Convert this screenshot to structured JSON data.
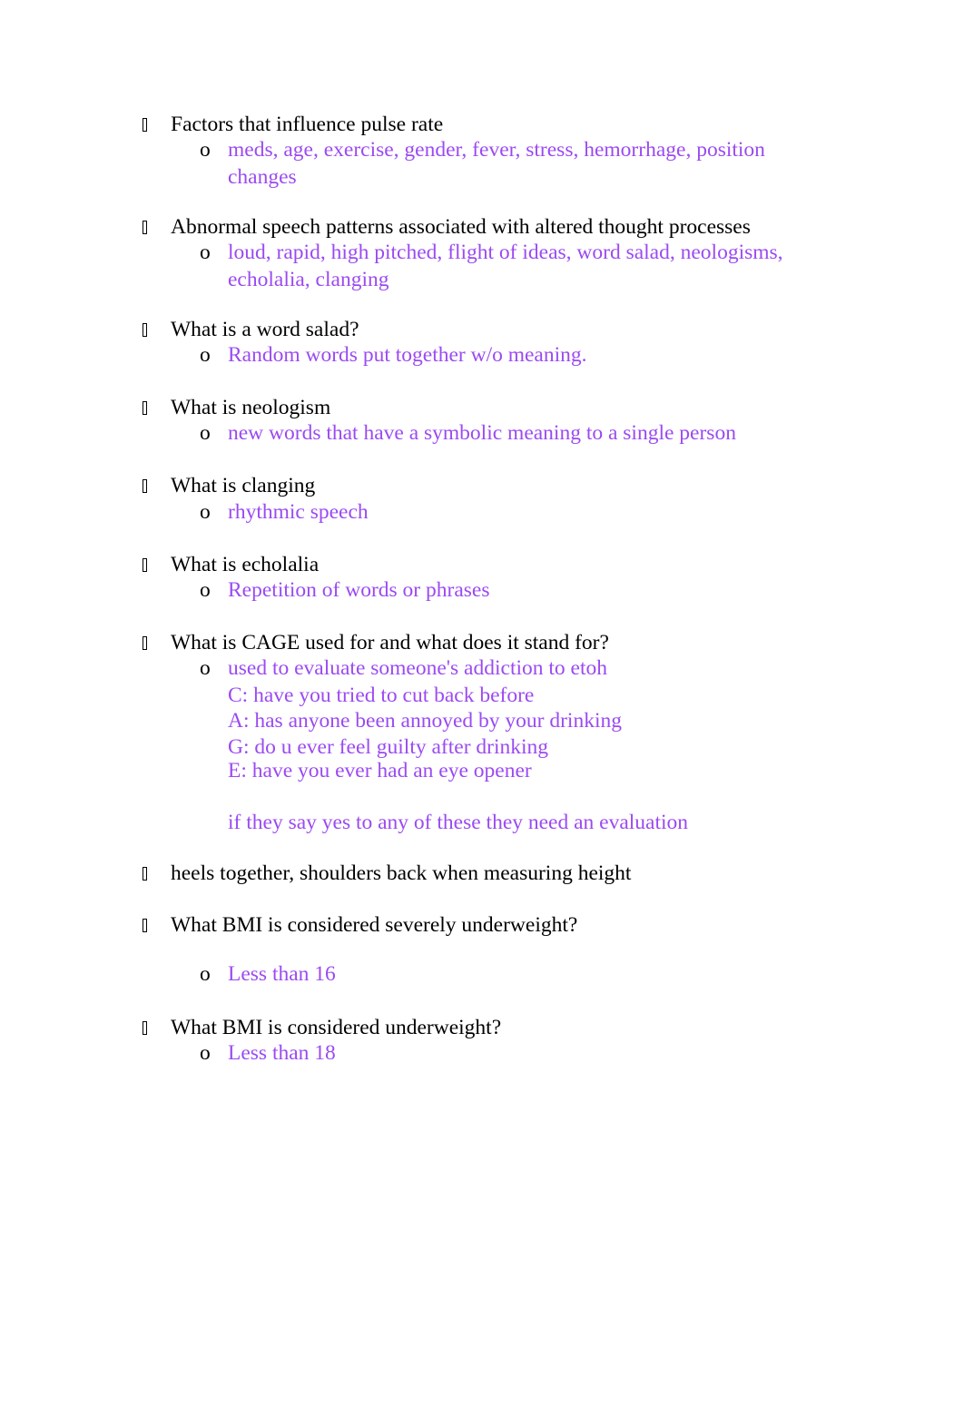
{
  "document": {
    "accent_color": "#9b4af2",
    "bullet_icon": "missing-glyph-box",
    "sub_bullet_char": "o",
    "items": [
      {
        "question": "Factors that influence pulse rate",
        "answer_lines": [
          "meds, age, exercise, gender, fever, stress, hemorrhage, position",
          "changes"
        ]
      },
      {
        "question": "Abnormal speech patterns associated with altered thought processes",
        "answer_lines": [
          "loud, rapid, high pitched, flight of ideas, word salad, neologisms,",
          "echolalia, clanging"
        ]
      },
      {
        "question": "What is a word salad?",
        "answer_lines": [
          "Random words put together w/o meaning."
        ]
      },
      {
        "question": "What is neologism",
        "answer_lines": [
          "new words that have a symbolic meaning to a single person"
        ]
      },
      {
        "question": "What is clanging",
        "answer_lines": [
          "rhythmic speech"
        ]
      },
      {
        "question": "What is echolalia",
        "answer_lines": [
          "Repetition of words or phrases"
        ]
      },
      {
        "question": "What is CAGE used for and what does it stand for?",
        "answer_lines": [
          "used to evaluate someone's addiction to etoh",
          "C: have you tried to cut back before",
          "A: has anyone been annoyed by your drinking",
          "G: do u ever feel guilty after drinking",
          "E: have you ever had an eye opener",
          "if they say yes to any of these they need an evaluation"
        ]
      },
      {
        "question": "heels together, shoulders back when measuring height",
        "answer_lines": []
      },
      {
        "question": "What BMI is considered severely underweight?",
        "answer_lines": [
          "Less than 16"
        ]
      },
      {
        "question": "What BMI is considered underweight?",
        "answer_lines": [
          "Less than 18"
        ]
      }
    ]
  }
}
